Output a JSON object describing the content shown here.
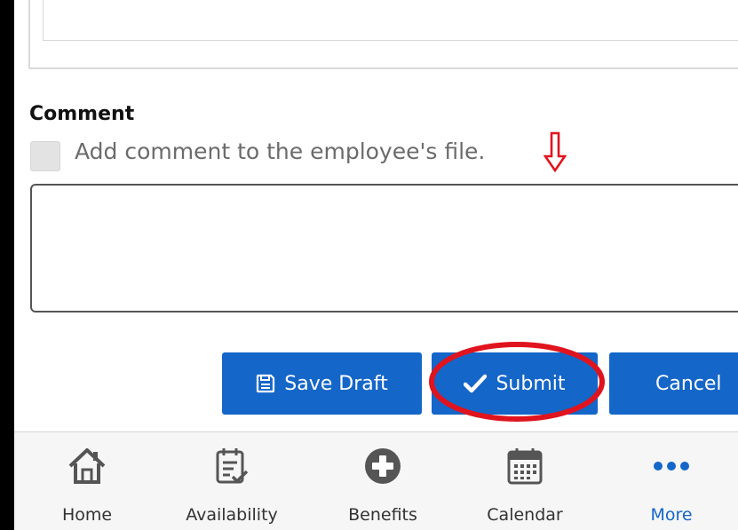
{
  "comment": {
    "heading": "Comment",
    "checkbox_label": "Add comment to the employee's file.",
    "checkbox_checked": false,
    "textarea_value": ""
  },
  "actions": {
    "save_draft_label": "Save Draft",
    "submit_label": "Submit",
    "cancel_label": "Cancel"
  },
  "tabbar": {
    "items": [
      {
        "label": "Home",
        "icon": "home-icon"
      },
      {
        "label": "Availability",
        "icon": "availability-calendar-icon"
      },
      {
        "label": "Benefits",
        "icon": "plus-circle-icon"
      },
      {
        "label": "Calendar",
        "icon": "calendar-icon"
      },
      {
        "label": "More",
        "icon": "more-dots-icon",
        "active": true
      }
    ]
  },
  "colors": {
    "primary": "#1466c8",
    "annotation_red": "#e0141e",
    "tabbar_bg": "#f6f6f6",
    "icon_gray": "#555555"
  }
}
